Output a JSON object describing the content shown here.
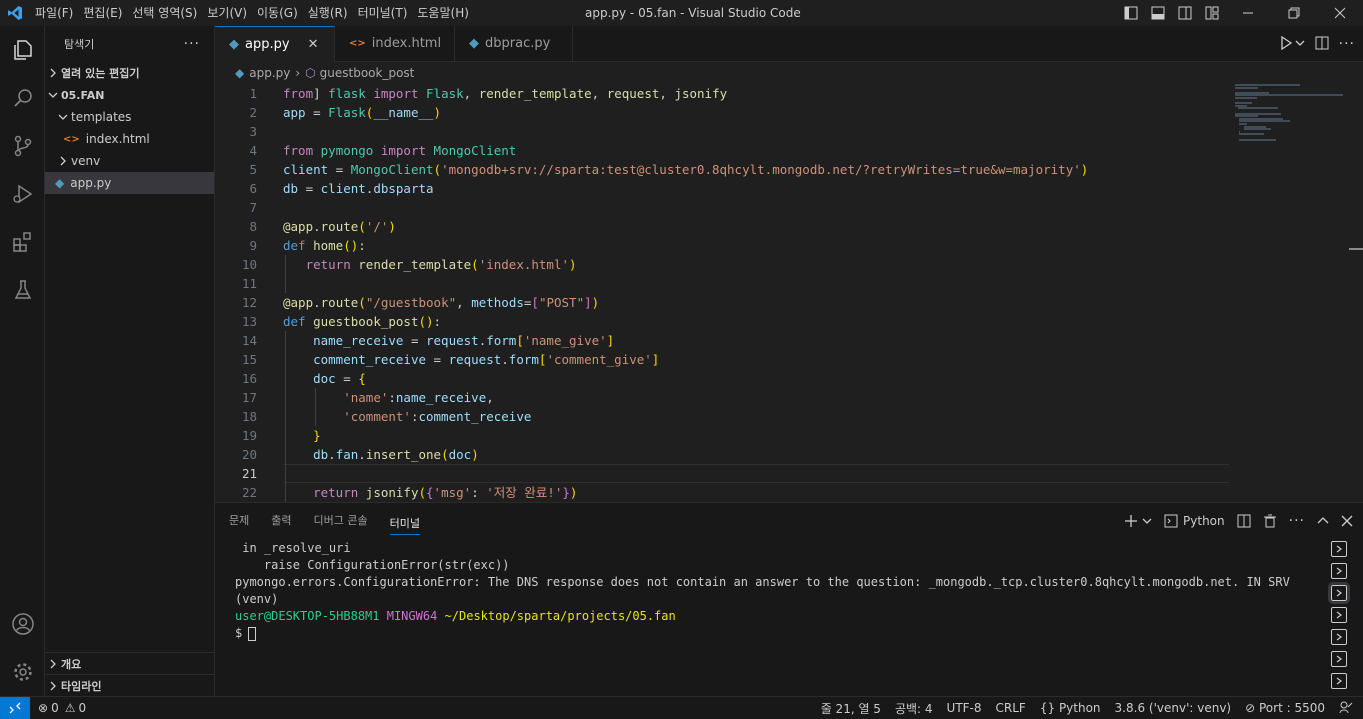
{
  "app": {
    "title": "app.py - 05.fan - Visual Studio Code",
    "menus": [
      "파일(F)",
      "편집(E)",
      "선택 영역(S)",
      "보기(V)",
      "이동(G)",
      "실행(R)",
      "터미널(T)",
      "도움말(H)"
    ]
  },
  "sidebar": {
    "title": "탐색기",
    "open_editors": "열려 있는 편집기",
    "folder": "05.FAN",
    "tree": [
      {
        "label": "templates",
        "type": "folder-open",
        "indent": 1
      },
      {
        "label": "index.html",
        "type": "html",
        "indent": 2
      },
      {
        "label": "venv",
        "type": "folder",
        "indent": 1
      },
      {
        "label": "app.py",
        "type": "python",
        "indent": 1,
        "active": true
      }
    ],
    "outline": "개요",
    "timeline": "타임라인"
  },
  "tabs": [
    {
      "label": "app.py",
      "type": "python",
      "active": true
    },
    {
      "label": "index.html",
      "type": "html",
      "active": false
    },
    {
      "label": "dbprac.py",
      "type": "python",
      "active": false
    }
  ],
  "breadcrumb": {
    "file": "app.py",
    "symbol": "guestbook_post"
  },
  "code": {
    "current_line": 21,
    "lines": [
      [
        [
          "kw",
          "from"
        ],
        [
          "",
          "] "
        ],
        [
          "cls",
          "flask"
        ],
        [
          "",
          " "
        ],
        [
          "kw",
          "import"
        ],
        [
          "",
          " "
        ],
        [
          "cls",
          "Flask"
        ],
        [
          "",
          ", "
        ],
        [
          "fn",
          "render_template"
        ],
        [
          "",
          ", "
        ],
        [
          "fn",
          "request"
        ],
        [
          "",
          ", "
        ],
        [
          "fn",
          "jsonify"
        ]
      ],
      [
        [
          "var",
          "app"
        ],
        [
          "",
          " = "
        ],
        [
          "cls",
          "Flask"
        ],
        [
          "br1",
          "("
        ],
        [
          "var",
          "__name__"
        ],
        [
          "br1",
          ")"
        ]
      ],
      [],
      [
        [
          "kw",
          "from"
        ],
        [
          "",
          " "
        ],
        [
          "cls",
          "pymongo"
        ],
        [
          "",
          " "
        ],
        [
          "kw",
          "import"
        ],
        [
          "",
          " "
        ],
        [
          "cls",
          "MongoClient"
        ]
      ],
      [
        [
          "var",
          "client"
        ],
        [
          "",
          " = "
        ],
        [
          "cls",
          "MongoClient"
        ],
        [
          "br1",
          "("
        ],
        [
          "str",
          "'mongodb+srv://sparta:test@cluster0.8qhcylt.mongodb.net/?retryWrites=true&w=majority'"
        ],
        [
          "br1",
          ")"
        ]
      ],
      [
        [
          "var",
          "db"
        ],
        [
          "",
          " = "
        ],
        [
          "var",
          "client"
        ],
        [
          "",
          "."
        ],
        [
          "var",
          "dbsparta"
        ]
      ],
      [],
      [
        [
          "fn",
          "@app"
        ],
        [
          "",
          "."
        ],
        [
          "fn",
          "route"
        ],
        [
          "br1",
          "("
        ],
        [
          "str",
          "'/'"
        ],
        [
          "br1",
          ")"
        ]
      ],
      [
        [
          "kwb",
          "def"
        ],
        [
          "",
          " "
        ],
        [
          "fn",
          "home"
        ],
        [
          "br1",
          "()"
        ],
        [
          "",
          ":"
        ]
      ],
      [
        [
          "",
          "   "
        ],
        [
          "kw",
          "return"
        ],
        [
          "",
          " "
        ],
        [
          "fn",
          "render_template"
        ],
        [
          "br1",
          "("
        ],
        [
          "str",
          "'index.html'"
        ],
        [
          "br1",
          ")"
        ]
      ],
      [],
      [
        [
          "fn",
          "@app"
        ],
        [
          "",
          "."
        ],
        [
          "fn",
          "route"
        ],
        [
          "br1",
          "("
        ],
        [
          "str",
          "\"/guestbook\""
        ],
        [
          "",
          ", "
        ],
        [
          "var",
          "methods"
        ],
        [
          "",
          "="
        ],
        [
          "br2",
          "["
        ],
        [
          "str",
          "\"POST\""
        ],
        [
          "br2",
          "]"
        ],
        [
          "br1",
          ")"
        ]
      ],
      [
        [
          "kwb",
          "def"
        ],
        [
          "",
          " "
        ],
        [
          "fn",
          "guestbook_post"
        ],
        [
          "br1",
          "()"
        ],
        [
          "",
          ":"
        ]
      ],
      [
        [
          "",
          "    "
        ],
        [
          "var",
          "name_receive"
        ],
        [
          "",
          " = "
        ],
        [
          "var",
          "request"
        ],
        [
          "",
          "."
        ],
        [
          "var",
          "form"
        ],
        [
          "br1",
          "["
        ],
        [
          "str",
          "'name_give'"
        ],
        [
          "br1",
          "]"
        ]
      ],
      [
        [
          "",
          "    "
        ],
        [
          "var",
          "comment_receive"
        ],
        [
          "",
          " = "
        ],
        [
          "var",
          "request"
        ],
        [
          "",
          "."
        ],
        [
          "var",
          "form"
        ],
        [
          "br1",
          "["
        ],
        [
          "str",
          "'comment_give'"
        ],
        [
          "br1",
          "]"
        ]
      ],
      [
        [
          "",
          "    "
        ],
        [
          "var",
          "doc"
        ],
        [
          "",
          " = "
        ],
        [
          "br1",
          "{"
        ]
      ],
      [
        [
          "",
          "        "
        ],
        [
          "str",
          "'name'"
        ],
        [
          "",
          ":"
        ],
        [
          "var",
          "name_receive"
        ],
        [
          "",
          ","
        ]
      ],
      [
        [
          "",
          "        "
        ],
        [
          "str",
          "'comment'"
        ],
        [
          "",
          ":"
        ],
        [
          "var",
          "comment_receive"
        ]
      ],
      [
        [
          "",
          "    "
        ],
        [
          "br1",
          "}"
        ]
      ],
      [
        [
          "",
          "    "
        ],
        [
          "var",
          "db"
        ],
        [
          "",
          "."
        ],
        [
          "var",
          "fan"
        ],
        [
          "",
          "."
        ],
        [
          "fn",
          "insert_one"
        ],
        [
          "br1",
          "("
        ],
        [
          "var",
          "doc"
        ],
        [
          "br1",
          ")"
        ]
      ],
      [],
      [
        [
          "",
          "    "
        ],
        [
          "kw",
          "return"
        ],
        [
          "",
          " "
        ],
        [
          "fn",
          "jsonify"
        ],
        [
          "br1",
          "("
        ],
        [
          "br2",
          "{"
        ],
        [
          "str",
          "'msg'"
        ],
        [
          "",
          ": "
        ],
        [
          "str",
          "'저장 완료!'"
        ],
        [
          "br2",
          "}"
        ],
        [
          "br1",
          ")"
        ]
      ]
    ]
  },
  "panel": {
    "tabs": [
      "문제",
      "출력",
      "디버그 콘솔",
      "터미널"
    ],
    "active_tab": "터미널",
    "shell_label": "Python",
    "terminal_count": 7,
    "selected_terminal": 3,
    "lines": [
      {
        "text": " in _resolve_uri"
      },
      {
        "text": "    raise ConfigurationError(str(exc))"
      },
      {
        "text": "pymongo.errors.ConfigurationError: The DNS response does not contain an answer to the question: _mongodb._tcp.cluster0.8qhcylt.mongodb.net. IN SRV"
      },
      {
        "text": "(venv)"
      }
    ],
    "prompt": {
      "user": "user@DESKTOP-5HB88M1",
      "shell": "MINGW64",
      "path": "~/Desktop/sparta/projects/05.fan",
      "symbol": "$"
    }
  },
  "status": {
    "errors": "0",
    "warnings": "0",
    "position": "줄 21, 열 5",
    "spaces": "공백: 4",
    "encoding": "UTF-8",
    "eol": "CRLF",
    "language": "Python",
    "interpreter": "3.8.6 ('venv': venv)",
    "port": "Port : 5500"
  },
  "colors": {
    "accent": "#0078d4",
    "python_icon": "#519aba",
    "html_icon": "#e37933"
  },
  "icons": [
    "vscode-logo-icon",
    "explorer-icon",
    "search-icon",
    "source-control-icon",
    "run-debug-icon",
    "extensions-icon",
    "testing-icon",
    "account-icon",
    "settings-gear-icon",
    "python-file-icon",
    "html-file-icon",
    "close-icon",
    "run-icon",
    "split-editor-icon",
    "more-icon",
    "plus-icon",
    "chevron-down-icon",
    "terminal-icon",
    "split-terminal-icon",
    "trash-icon",
    "maximize-icon",
    "close-panel-icon",
    "remote-icon",
    "error-icon",
    "warning-icon",
    "braces-icon",
    "port-icon",
    "feedback-icon"
  ]
}
